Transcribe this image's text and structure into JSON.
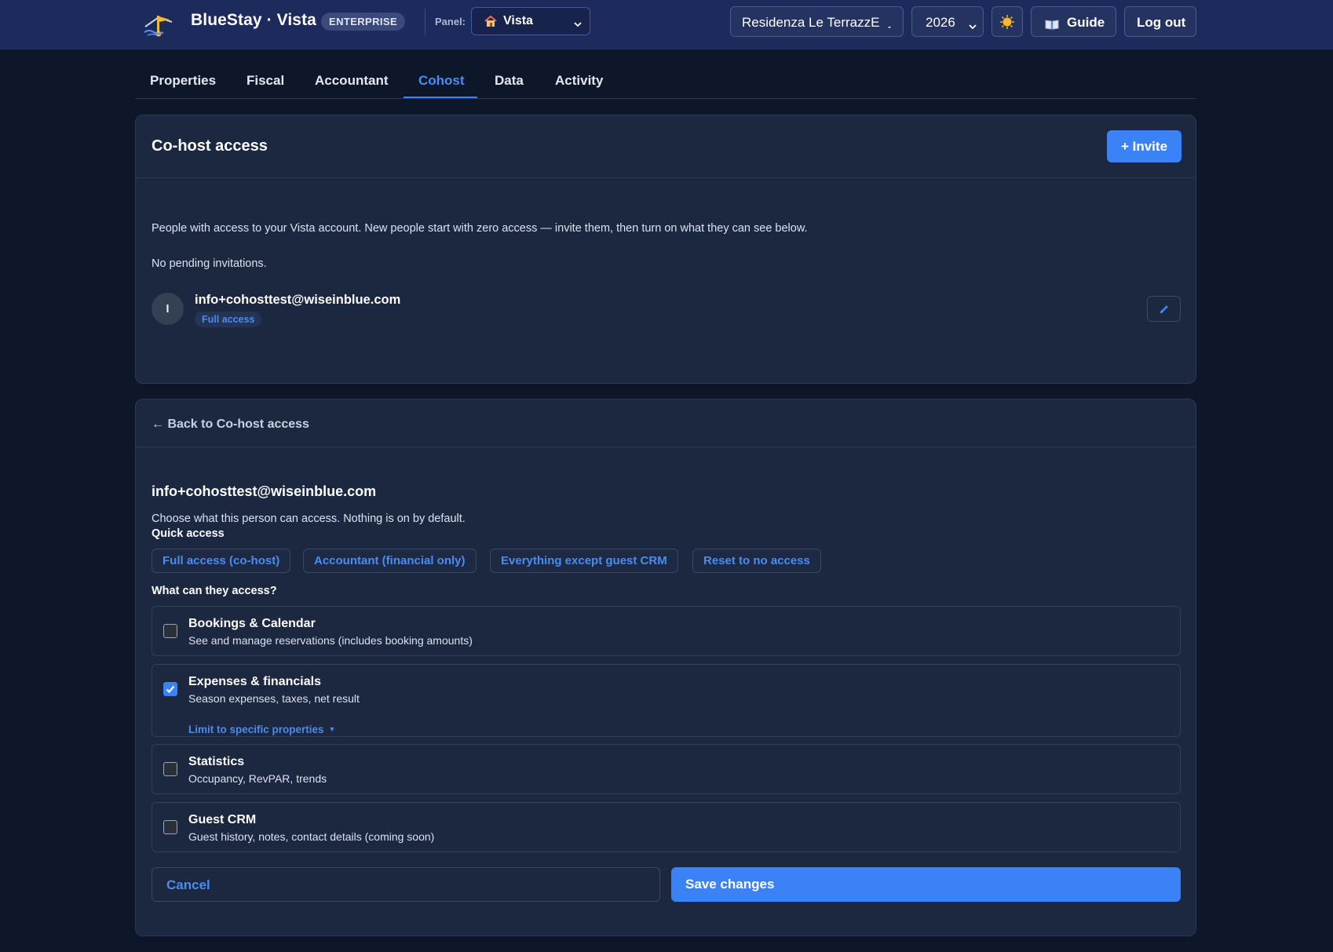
{
  "header": {
    "brand": "BlueStay · Vista",
    "plan_badge": "ENTERPRISE",
    "panel_label": "Panel:",
    "panel_value": "Vista",
    "property_value": "Residenza Le TerrazzE",
    "year_value": "2026",
    "guide_label": "Guide",
    "logout_label": "Log out"
  },
  "tabs": [
    {
      "label": "Properties"
    },
    {
      "label": "Fiscal"
    },
    {
      "label": "Accountant"
    },
    {
      "label": "Cohost",
      "active": true
    },
    {
      "label": "Data"
    },
    {
      "label": "Activity"
    }
  ],
  "cohost": {
    "title": "Co-host access",
    "invite_label": "+ Invite",
    "description": "People with access to your Vista account. New people start with zero access — invite them, then turn on what they can see below.",
    "no_pending": "No pending invitations.",
    "members": [
      {
        "initial": "I",
        "email": "info+cohosttest@wiseinblue.com",
        "badge": "Full access"
      }
    ]
  },
  "detail": {
    "back_label": "← Back to Co-host access",
    "email": "info+cohosttest@wiseinblue.com",
    "description": "Choose what this person can access. Nothing is on by default.",
    "quick_access_label": "Quick access",
    "quick_access": [
      {
        "label": "Full access (co-host)"
      },
      {
        "label": "Accountant (financial only)"
      },
      {
        "label": "Everything except guest CRM"
      },
      {
        "label": "Reset to no access"
      }
    ],
    "what_label": "What can they access?",
    "permissions": [
      {
        "title": "Bookings & Calendar",
        "subtitle": "See and manage reservations (includes booking amounts)",
        "checked": false
      },
      {
        "title": "Expenses & financials",
        "subtitle": "Season expenses, taxes, net result",
        "checked": true,
        "limit_label": "Limit to specific properties"
      },
      {
        "title": "Statistics",
        "subtitle": "Occupancy, RevPAR, trends",
        "checked": false
      },
      {
        "title": "Guest CRM",
        "subtitle": "Guest history, notes, contact details (coming soon)",
        "checked": false
      }
    ],
    "cancel_label": "Cancel",
    "save_label": "Save changes"
  },
  "colors": {
    "accent": "#3b82f6",
    "topbar": "#1c2a5c",
    "background": "#0e1629",
    "card": "#1c2740"
  },
  "icons": {
    "logo": "bluestay-logo-icon",
    "house": "house-icon",
    "theme": "sun-icon",
    "guide": "book-icon",
    "edit": "pencil-icon",
    "check": "check-icon"
  }
}
